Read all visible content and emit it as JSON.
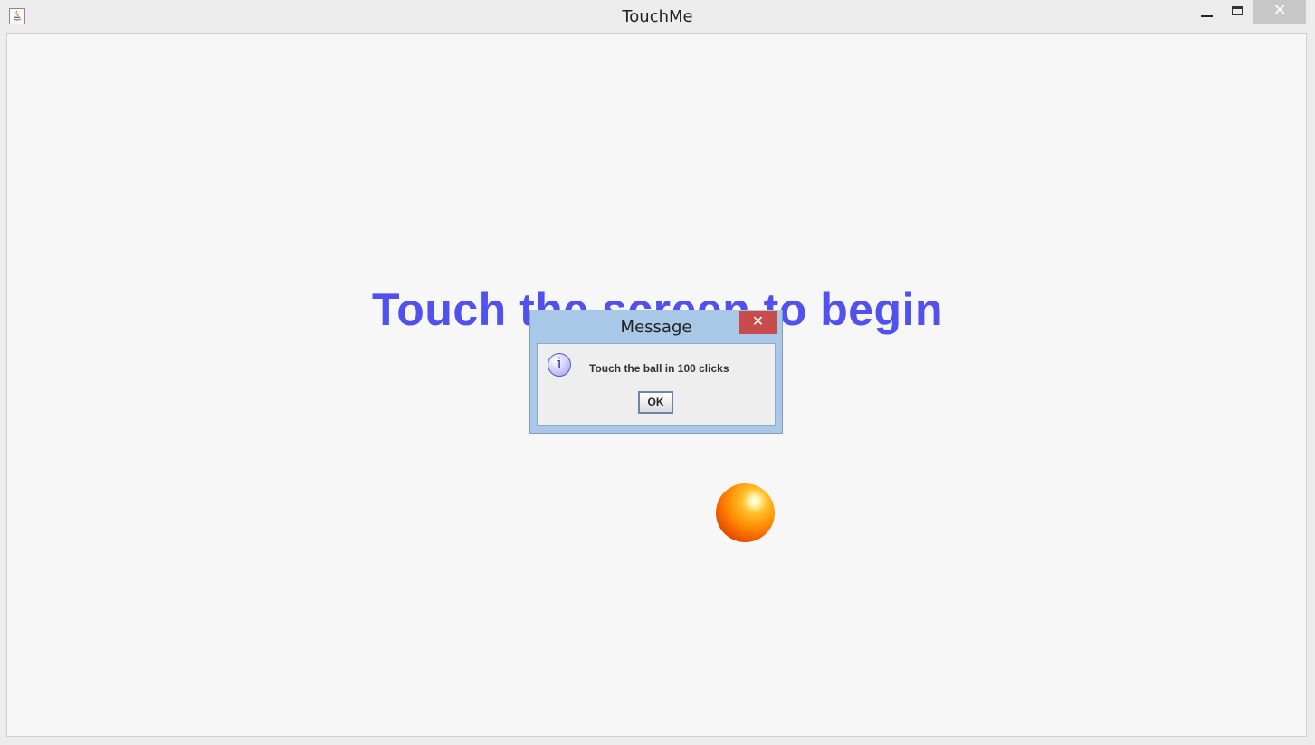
{
  "window": {
    "title": "TouchMe",
    "close_glyph": "✕"
  },
  "canvas": {
    "headline": "Touch the screen to begin",
    "headline_color": "#5151ee",
    "ball_color": "#ff8a00"
  },
  "dialog": {
    "title": "Message",
    "close_glyph": "✕",
    "icon": "info-icon",
    "icon_glyph": "i",
    "message": "Touch the ball in 100 clicks",
    "ok_label": "OK"
  }
}
